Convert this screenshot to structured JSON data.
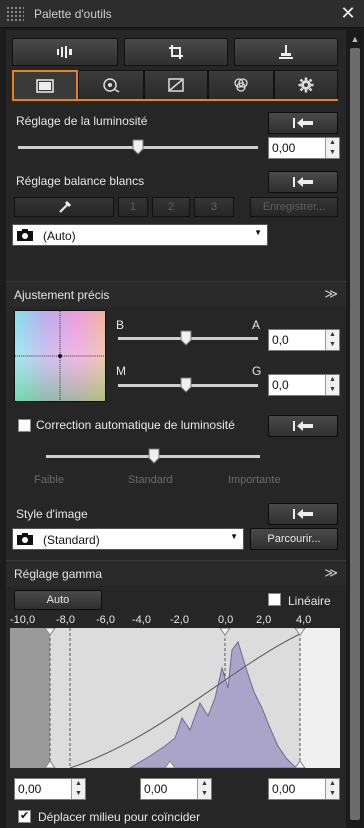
{
  "window": {
    "title": "Palette d'outils",
    "close_glyph": "✕"
  },
  "brightness": {
    "label": "Réglage de la luminosité",
    "value": "0,00",
    "level": 0.5
  },
  "white_balance": {
    "label": "Réglage balance blancs",
    "buttons": [
      "1",
      "2",
      "3",
      "Enregistrer..."
    ],
    "selected": "(Auto)"
  },
  "fine_tune": {
    "label": "Ajustement précis",
    "axis1_left": "B",
    "axis1_right": "A",
    "value1": "0,0",
    "axis2_left": "M",
    "axis2_right": "G",
    "value2": "0,0"
  },
  "auto_lighting": {
    "label": "Correction automatique de luminosité",
    "checked": false,
    "levels": [
      "Faible",
      "Standard",
      "Importante"
    ]
  },
  "picture_style": {
    "label": "Style d'image",
    "selected": "(Standard)",
    "browse_label": "Parcourir..."
  },
  "gamma": {
    "label": "Réglage gamma",
    "auto_label": "Auto",
    "linear_label": "Linéaire",
    "linear_checked": false,
    "scale": [
      "-10,0",
      "-8,0",
      "-6,0",
      "-4,0",
      "-2,0",
      "0,0",
      "2,0",
      "4,0"
    ],
    "values": [
      "0,00",
      "0,00",
      "0,00"
    ],
    "midpoint_label": "Déplacer milieu pour coïncider",
    "midpoint_checked": true
  },
  "icons": {
    "top_buttons": [
      "histogram-icon",
      "crop-icon",
      "stamp-icon"
    ],
    "tabs": [
      "brightness-tab-icon",
      "lens-tab-icon",
      "tone-tab-icon",
      "color-tab-icon",
      "settings-tab-icon"
    ]
  },
  "colors": {
    "accent": "#e5821b",
    "panel": "#262626",
    "histogram": "#a9a3c6"
  }
}
